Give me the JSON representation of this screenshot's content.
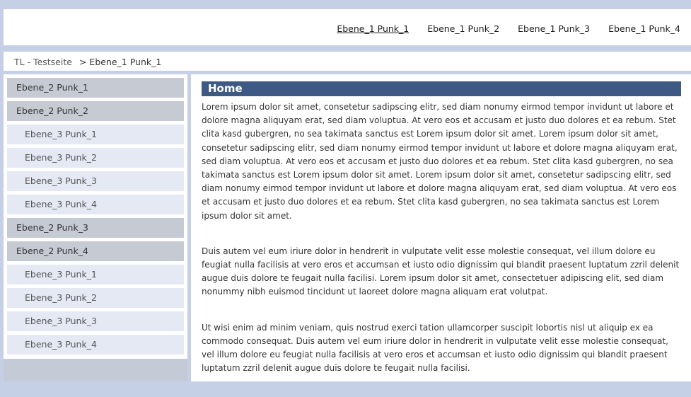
{
  "topnav": {
    "items": [
      "Ebene_1 Punk_1",
      "Ebene_1 Punk_2",
      "Ebene_1 Punk_3",
      "Ebene_1 Punk_4"
    ]
  },
  "breadcrumb": {
    "root": "TL - Testseite",
    "separator": ">",
    "current": "Ebene_1 Punk_1"
  },
  "sidebar": {
    "items": [
      {
        "label": "Ebene_2 Punk_1"
      },
      {
        "label": "Ebene_2 Punk_2"
      },
      {
        "label": "Ebene_3 Punk_1"
      },
      {
        "label": "Ebene_3 Punk_2"
      },
      {
        "label": "Ebene_3 Punk_3"
      },
      {
        "label": "Ebene_3 Punk_4"
      },
      {
        "label": "Ebene_2 Punk_3"
      },
      {
        "label": "Ebene_2 Punk_4"
      },
      {
        "label": "Ebene_3 Punk_1"
      },
      {
        "label": "Ebene_3 Punk_2"
      },
      {
        "label": "Ebene_3 Punk_3"
      },
      {
        "label": "Ebene_3 Punk_4"
      }
    ]
  },
  "main": {
    "title": "Home",
    "paragraphs": [
      "Lorem ipsum dolor sit amet, consetetur sadipscing elitr, sed diam nonumy eirmod tempor invidunt ut labore et dolore magna aliquyam erat, sed diam voluptua. At vero eos et accusam et justo duo dolores et ea rebum. Stet clita kasd gubergren, no sea takimata sanctus est Lorem ipsum dolor sit amet. Lorem ipsum dolor sit amet, consetetur sadipscing elitr, sed diam nonumy eirmod tempor invidunt ut labore et dolore magna aliquyam erat, sed diam voluptua. At vero eos et accusam et justo duo dolores et ea rebum. Stet clita kasd gubergren, no sea takimata sanctus est Lorem ipsum dolor sit amet. Lorem ipsum dolor sit amet, consetetur sadipscing elitr, sed diam nonumy eirmod tempor invidunt ut labore et dolore magna aliquyam erat, sed diam voluptua. At vero eos et accusam et justo duo dolores et ea rebum. Stet clita kasd gubergren, no sea takimata sanctus est Lorem ipsum dolor sit amet.",
      "Duis autem vel eum iriure dolor in hendrerit in vulputate velit esse molestie consequat, vel illum dolore eu feugiat nulla facilisis at vero eros et accumsan et iusto odio dignissim qui blandit praesent luptatum zzril delenit augue duis dolore te feugait nulla facilisi. Lorem ipsum dolor sit amet, consectetuer adipiscing elit, sed diam nonummy nibh euismod tincidunt ut laoreet dolore magna aliquam erat volutpat.",
      "Ut wisi enim ad minim veniam, quis nostrud exerci tation ullamcorper suscipit lobortis nisl ut aliquip ex ea commodo consequat. Duis autem vel eum iriure dolor in hendrerit in vulputate velit esse molestie consequat, vel illum dolore eu feugiat nulla facilisis at vero eros et accumsan et iusto odio dignissim qui blandit praesent luptatum zzril delenit augue duis dolore te feugait nulla facilisi."
    ]
  },
  "colors": {
    "background": "#c5d0e6",
    "heading_bar": "#3e5a84",
    "level2_item": "#c5cad3",
    "level3_item": "#e4e9f4"
  }
}
